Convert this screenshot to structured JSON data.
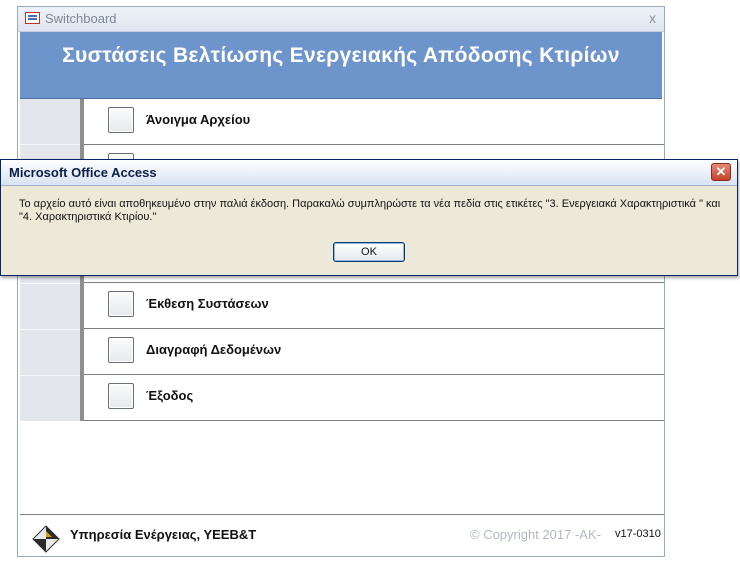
{
  "switchboard": {
    "window_title": "Switchboard",
    "close_glyph": "x",
    "banner_title": "Συστάσεις Βελτίωσης Ενεργειακής Απόδοσης Κτιρίων",
    "items": [
      {
        "label": "Άνοιγμα Αρχείου"
      },
      {
        "label": ""
      },
      {
        "label": ""
      },
      {
        "label": ""
      },
      {
        "label": "Έκθεση Συστάσεων"
      },
      {
        "label": "Διαγραφή Δεδομένων"
      },
      {
        "label": "Έξοδος"
      }
    ],
    "footer": {
      "organization": "Υπηρεσία Ενέργειας, ΥΕΕΒ&Τ",
      "copyright": "© Copyright 2017 -AK-",
      "version": "v17-0310"
    }
  },
  "dialog": {
    "title": "Microsoft Office Access",
    "close_glyph": "✕",
    "message": "Το αρχείο αυτό είναι αποθηκευμένο στην παλιά έκδοση. Παρακαλώ συμπληρώστε τα νέα πεδία στις ετικέτες \"3. Ενεργειακά Χαρακτηριστικά \" και \"4. Χαρακτηριστικά Κτιρίου.\"",
    "ok_label": "OK"
  },
  "colors": {
    "banner": "#6e94cc",
    "dialog_bg": "#ece9d8",
    "dialog_close": "#c6402a"
  }
}
